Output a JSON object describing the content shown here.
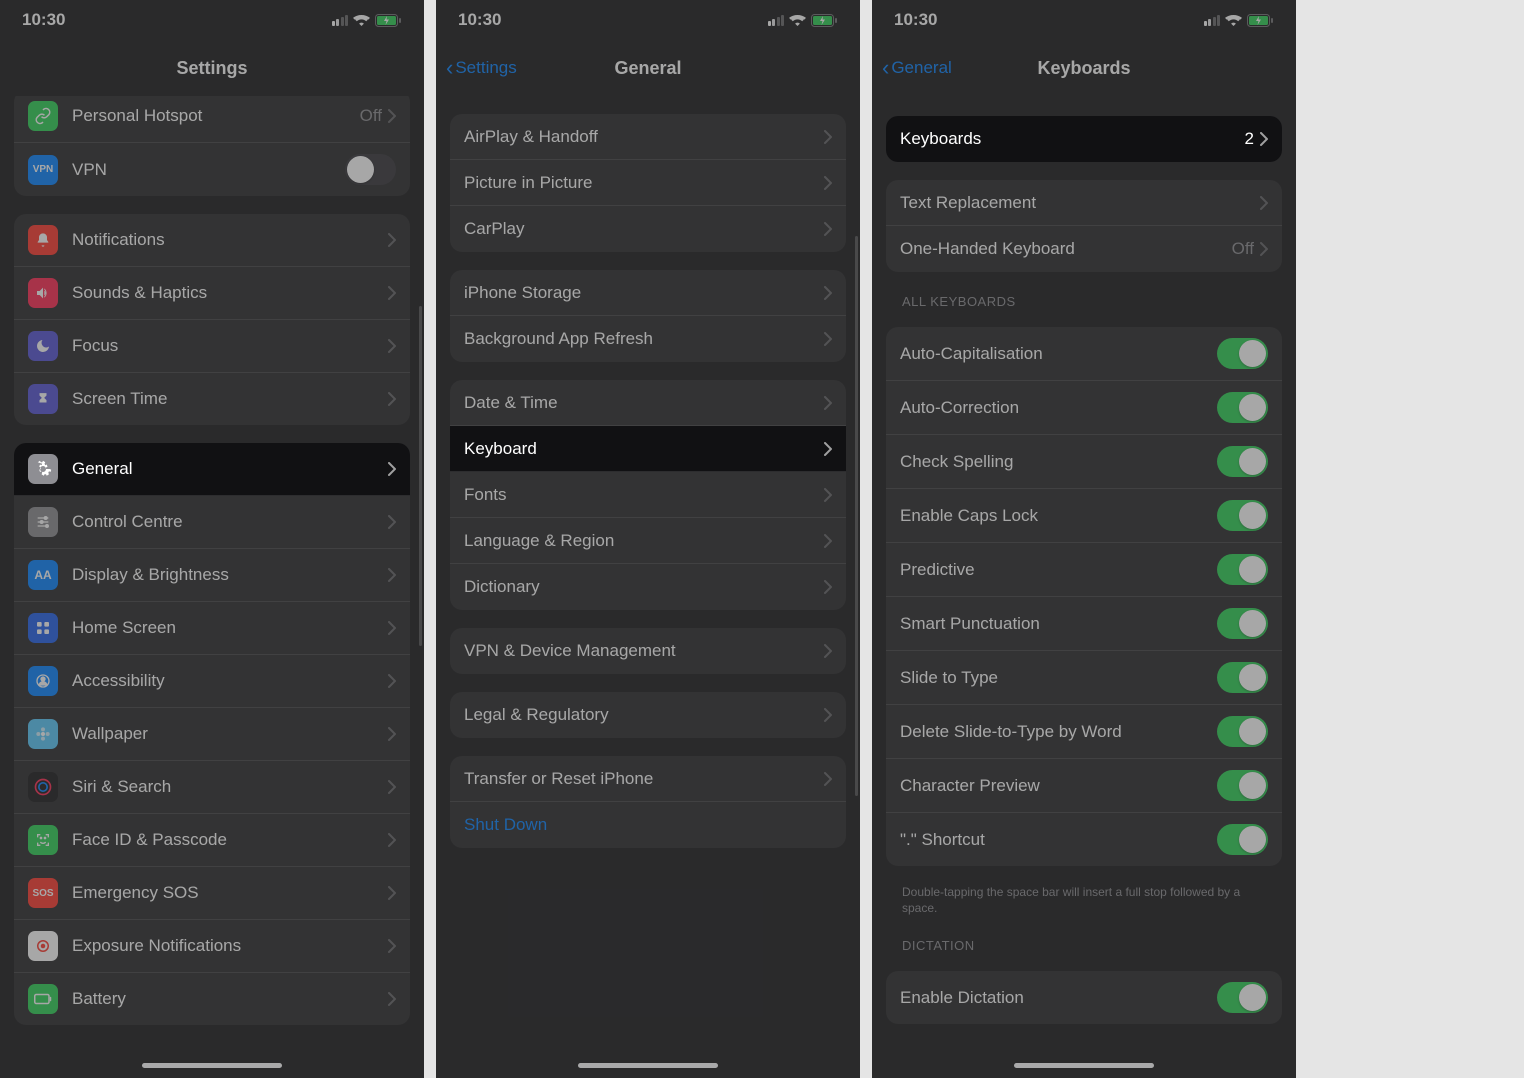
{
  "status": {
    "time": "10:30"
  },
  "screen1": {
    "title": "Settings",
    "groups": [
      {
        "rows": [
          {
            "name": "personal-hotspot",
            "icon_bg": "#30d158",
            "icon": "link",
            "label": "Personal Hotspot",
            "value": "Off",
            "type": "nav"
          },
          {
            "name": "vpn",
            "icon_bg": "#0a84ff",
            "icon": "vpn",
            "label": "VPN",
            "type": "toggle",
            "on": false
          }
        ]
      },
      {
        "rows": [
          {
            "name": "notifications",
            "icon_bg": "#ff3b30",
            "icon": "bell",
            "label": "Notifications",
            "type": "nav"
          },
          {
            "name": "sounds-haptics",
            "icon_bg": "#ff2d55",
            "icon": "speaker",
            "label": "Sounds & Haptics",
            "type": "nav"
          },
          {
            "name": "focus",
            "icon_bg": "#5856d6",
            "icon": "moon",
            "label": "Focus",
            "type": "nav"
          },
          {
            "name": "screen-time",
            "icon_bg": "#5856d6",
            "icon": "hourglass",
            "label": "Screen Time",
            "type": "nav"
          }
        ]
      },
      {
        "rows": [
          {
            "name": "general",
            "icon_bg": "#8e8e93",
            "icon": "gear",
            "label": "General",
            "type": "nav",
            "highlight": true
          },
          {
            "name": "control-centre",
            "icon_bg": "#8e8e93",
            "icon": "sliders",
            "label": "Control Centre",
            "type": "nav"
          },
          {
            "name": "display-brightness",
            "icon_bg": "#0a84ff",
            "icon": "aa",
            "label": "Display & Brightness",
            "type": "nav"
          },
          {
            "name": "home-screen",
            "icon_bg": "#2563eb",
            "icon": "grid",
            "label": "Home Screen",
            "type": "nav"
          },
          {
            "name": "accessibility",
            "icon_bg": "#0a84ff",
            "icon": "person",
            "label": "Accessibility",
            "type": "nav"
          },
          {
            "name": "wallpaper",
            "icon_bg": "#5ac8fa",
            "icon": "flower",
            "label": "Wallpaper",
            "type": "nav"
          },
          {
            "name": "siri-search",
            "icon_bg": "#1c1c1e",
            "icon": "siri",
            "label": "Siri & Search",
            "type": "nav"
          },
          {
            "name": "face-id",
            "icon_bg": "#30d158",
            "icon": "face",
            "label": "Face ID & Passcode",
            "type": "nav"
          },
          {
            "name": "emergency-sos",
            "icon_bg": "#ff3b30",
            "icon": "sos",
            "label": "Emergency SOS",
            "type": "nav"
          },
          {
            "name": "exposure",
            "icon_bg": "#ffffff",
            "icon": "exposure",
            "label": "Exposure Notifications",
            "type": "nav"
          },
          {
            "name": "battery",
            "icon_bg": "#30d158",
            "icon": "battery",
            "label": "Battery",
            "type": "nav"
          }
        ]
      }
    ]
  },
  "screen2": {
    "back": "Settings",
    "title": "General",
    "groups": [
      {
        "rows": [
          {
            "name": "airplay-handoff",
            "label": "AirPlay & Handoff",
            "type": "nav"
          },
          {
            "name": "pip",
            "label": "Picture in Picture",
            "type": "nav"
          },
          {
            "name": "carplay",
            "label": "CarPlay",
            "type": "nav"
          }
        ]
      },
      {
        "rows": [
          {
            "name": "iphone-storage",
            "label": "iPhone Storage",
            "type": "nav"
          },
          {
            "name": "bg-refresh",
            "label": "Background App Refresh",
            "type": "nav"
          }
        ]
      },
      {
        "rows": [
          {
            "name": "date-time",
            "label": "Date & Time",
            "type": "nav"
          },
          {
            "name": "keyboard",
            "label": "Keyboard",
            "type": "nav",
            "highlight": true
          },
          {
            "name": "fonts",
            "label": "Fonts",
            "type": "nav"
          },
          {
            "name": "language-region",
            "label": "Language & Region",
            "type": "nav"
          },
          {
            "name": "dictionary",
            "label": "Dictionary",
            "type": "nav"
          }
        ]
      },
      {
        "rows": [
          {
            "name": "vpn-device-mgmt",
            "label": "VPN & Device Management",
            "type": "nav"
          }
        ]
      },
      {
        "rows": [
          {
            "name": "legal",
            "label": "Legal & Regulatory",
            "type": "nav"
          }
        ]
      },
      {
        "rows": [
          {
            "name": "transfer-reset",
            "label": "Transfer or Reset iPhone",
            "type": "nav"
          },
          {
            "name": "shut-down",
            "label": "Shut Down",
            "type": "link"
          }
        ]
      }
    ]
  },
  "screen3": {
    "back": "General",
    "title": "Keyboards",
    "groups": [
      {
        "rows": [
          {
            "name": "keyboards",
            "label": "Keyboards",
            "value": "2",
            "type": "nav",
            "highlight": true
          }
        ]
      },
      {
        "rows": [
          {
            "name": "text-replacement",
            "label": "Text Replacement",
            "type": "nav"
          },
          {
            "name": "one-handed",
            "label": "One-Handed Keyboard",
            "value": "Off",
            "type": "nav"
          }
        ]
      },
      {
        "header": "ALL KEYBOARDS",
        "rows": [
          {
            "name": "auto-cap",
            "label": "Auto-Capitalisation",
            "type": "toggle",
            "on": true
          },
          {
            "name": "auto-correct",
            "label": "Auto-Correction",
            "type": "toggle",
            "on": true
          },
          {
            "name": "check-spelling",
            "label": "Check Spelling",
            "type": "toggle",
            "on": true
          },
          {
            "name": "caps-lock",
            "label": "Enable Caps Lock",
            "type": "toggle",
            "on": true
          },
          {
            "name": "predictive",
            "label": "Predictive",
            "type": "toggle",
            "on": true
          },
          {
            "name": "smart-punct",
            "label": "Smart Punctuation",
            "type": "toggle",
            "on": true
          },
          {
            "name": "slide-type",
            "label": "Slide to Type",
            "type": "toggle",
            "on": true
          },
          {
            "name": "delete-slide",
            "label": "Delete Slide-to-Type by Word",
            "type": "toggle",
            "on": true
          },
          {
            "name": "char-preview",
            "label": "Character Preview",
            "type": "toggle",
            "on": true
          },
          {
            "name": "dot-shortcut",
            "label": "\".\" Shortcut",
            "type": "toggle",
            "on": true
          }
        ],
        "footer": "Double-tapping the space bar will insert a full stop followed by a space."
      },
      {
        "header": "DICTATION",
        "rows": [
          {
            "name": "enable-dictation",
            "label": "Enable Dictation",
            "type": "toggle",
            "on": true
          }
        ]
      }
    ]
  }
}
